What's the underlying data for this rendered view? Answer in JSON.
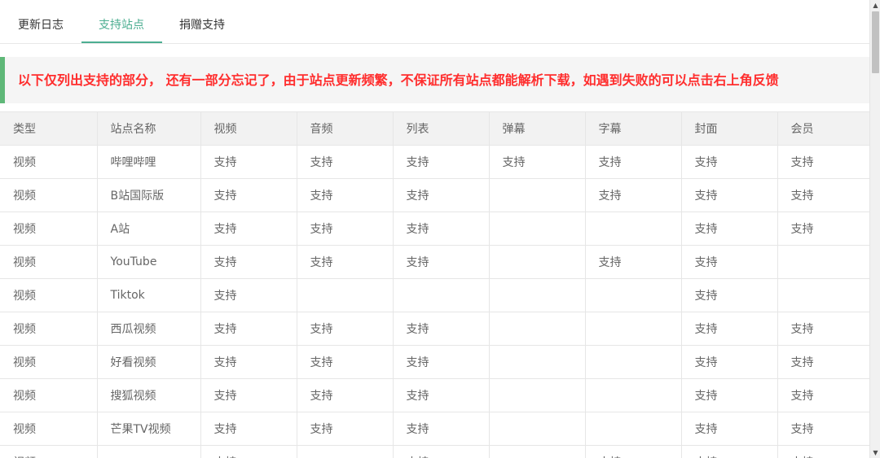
{
  "tabs": [
    {
      "label": "更新日志"
    },
    {
      "label": "支持站点"
    },
    {
      "label": "捐赠支持"
    }
  ],
  "active_tab": 1,
  "notice": {
    "text": "以下仅列出支持的部分， 还有一部分忘记了，由于站点更新频繁，不保证所有站点都能解析下载，如遇到失败的可以点击右上角反馈"
  },
  "table": {
    "headers": [
      "类型",
      "站点名称",
      "视频",
      "音频",
      "列表",
      "弹幕",
      "字幕",
      "封面",
      "会员"
    ],
    "rows": [
      [
        "视频",
        "哔哩哔哩",
        "支持",
        "支持",
        "支持",
        "支持",
        "支持",
        "支持",
        "支持"
      ],
      [
        "视频",
        "B站国际版",
        "支持",
        "支持",
        "支持",
        "",
        "支持",
        "支持",
        "支持"
      ],
      [
        "视频",
        "A站",
        "支持",
        "支持",
        "支持",
        "",
        "",
        "支持",
        "支持"
      ],
      [
        "视频",
        "YouTube",
        "支持",
        "支持",
        "支持",
        "",
        "支持",
        "支持",
        ""
      ],
      [
        "视频",
        "Tiktok",
        "支持",
        "",
        "",
        "",
        "",
        "支持",
        ""
      ],
      [
        "视频",
        "西瓜视频",
        "支持",
        "支持",
        "支持",
        "",
        "",
        "支持",
        "支持"
      ],
      [
        "视频",
        "好看视频",
        "支持",
        "支持",
        "支持",
        "",
        "",
        "支持",
        "支持"
      ],
      [
        "视频",
        "搜狐视频",
        "支持",
        "支持",
        "支持",
        "",
        "",
        "支持",
        "支持"
      ],
      [
        "视频",
        "芒果TV视频",
        "支持",
        "支持",
        "支持",
        "",
        "",
        "支持",
        "支持"
      ],
      [
        "视频",
        "",
        "支持",
        "",
        "支持",
        "",
        "支持",
        "支持",
        "支持"
      ]
    ]
  },
  "icons": {
    "scroll_up": "▲",
    "scroll_down": "▼"
  },
  "colors": {
    "accent": "#4cae91",
    "notice_text": "#ff2d2d",
    "notice_border": "#5fb878",
    "header_bg": "#f2f2f2"
  }
}
